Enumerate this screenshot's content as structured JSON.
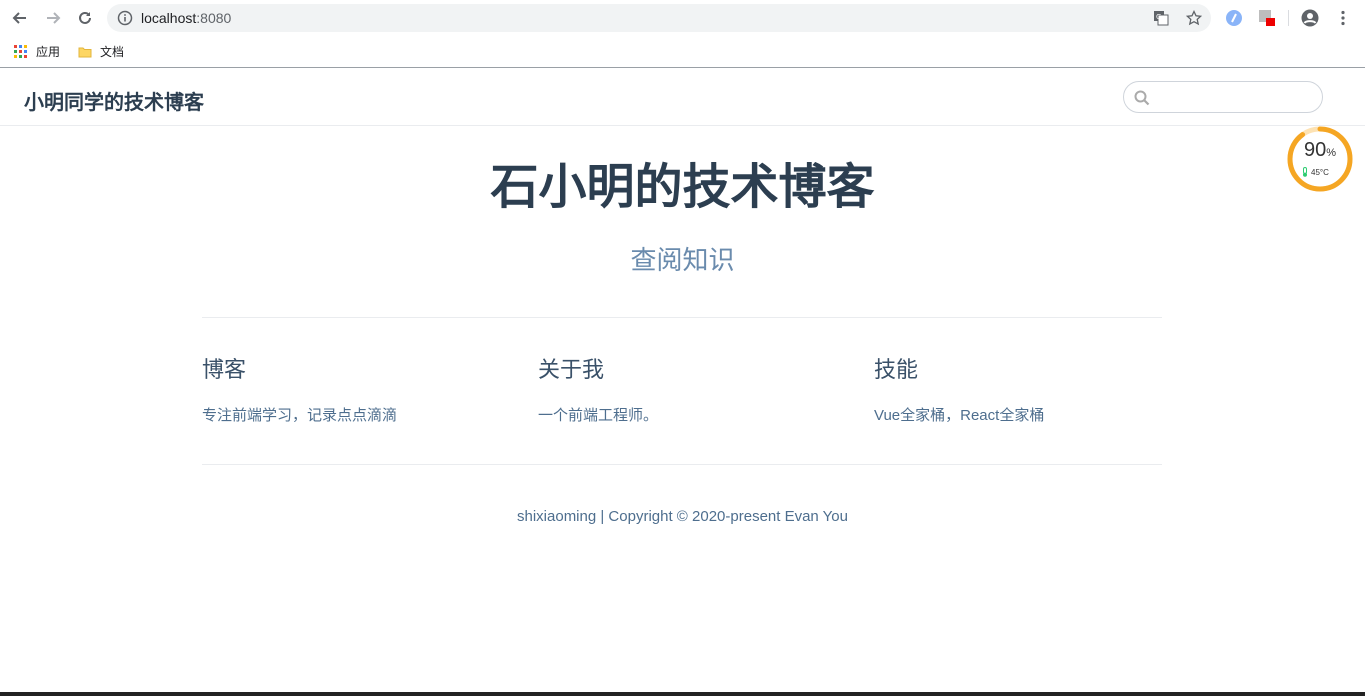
{
  "browser": {
    "url_host": "localhost",
    "url_port": ":8080",
    "bookmarks": [
      {
        "label": "应用",
        "icon": "apps-grid-icon"
      },
      {
        "label": "文档",
        "icon": "folder-icon"
      }
    ]
  },
  "site": {
    "nav_title": "小明同学的技术博客",
    "search_placeholder": "",
    "hero_title": "石小明的技术博客",
    "hero_description": "查阅知识",
    "features": [
      {
        "title": "博客",
        "details": "专注前端学习，记录点点滴滴"
      },
      {
        "title": "关于我",
        "details": "一个前端工程师。"
      },
      {
        "title": "技能",
        "details": "Vue全家桶，React全家桶"
      }
    ],
    "footer": "shixiaoming | Copyright © 2020-present Evan You"
  },
  "widget": {
    "percent": "90",
    "percent_unit": "%",
    "temperature": "45°C",
    "accent": "#f5a623"
  },
  "colors": {
    "title": "#2c3e50",
    "description": "#6a8bad",
    "text": "#4e6e8e"
  }
}
